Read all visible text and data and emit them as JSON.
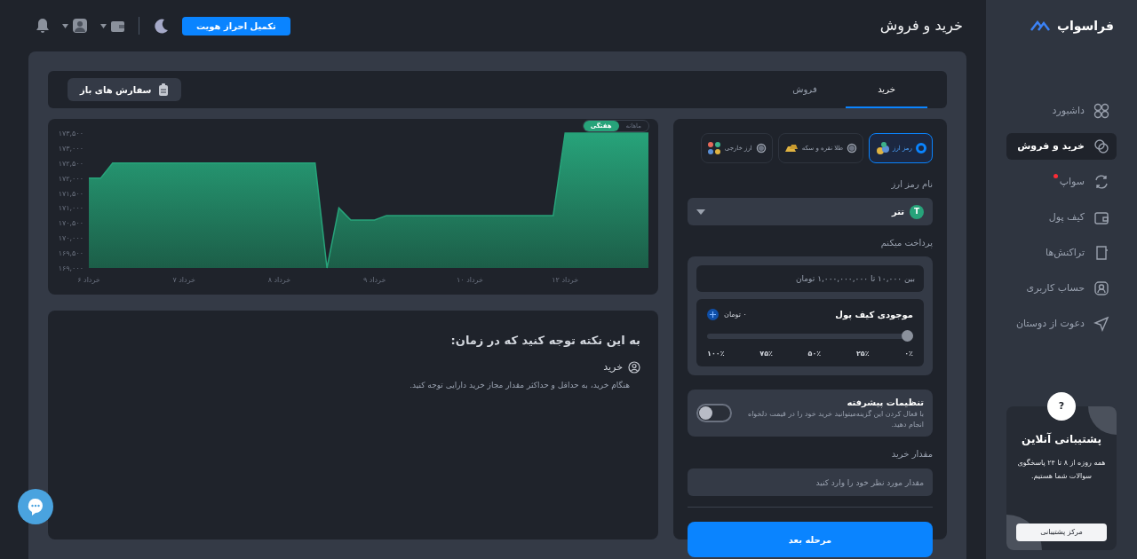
{
  "sidebar": {
    "logo": "فراسواپ",
    "items": [
      {
        "label": "داشبورد",
        "selected": false,
        "badge": false
      },
      {
        "label": "خرید و فروش",
        "selected": true,
        "badge": false
      },
      {
        "label": "سواپ",
        "selected": false,
        "badge": true
      },
      {
        "label": "کیف پول",
        "selected": false,
        "badge": false
      },
      {
        "label": "تراکنش‌ها",
        "selected": false,
        "badge": false
      },
      {
        "label": "حساب کاربری",
        "selected": false,
        "badge": false
      },
      {
        "label": "دعوت از دوستان",
        "selected": false,
        "badge": false
      }
    ],
    "support": {
      "badge": "?",
      "title": "پشتیبانی آنلاین",
      "text": "همه روزه از ۸ تا ۲۴ پاسخگوی سوالات شما هستیم.",
      "button": "مرکز پشتیبانی"
    }
  },
  "header": {
    "title": "خرید و فروش",
    "verify_button": "تکمیل احراز هویت"
  },
  "tabs": [
    {
      "label": "خرید",
      "selected": true
    },
    {
      "label": "فروش",
      "selected": false
    }
  ],
  "open_orders_button": "سفارش های باز",
  "chart": {
    "periods": [
      {
        "label": "ماهانه",
        "selected": false
      },
      {
        "label": "هفتگی",
        "selected": true
      }
    ],
    "chart_data": {
      "type": "area",
      "categories": [
        "۶ خرداد",
        null,
        null,
        null,
        null,
        null,
        null,
        null,
        "۷ خرداد",
        null,
        null,
        null,
        null,
        null,
        null,
        null,
        "۸ خرداد",
        null,
        null,
        null,
        null,
        null,
        null,
        null,
        "۹ خرداد",
        null,
        null,
        null,
        null,
        null,
        null,
        null,
        "۱۰ خرداد",
        null,
        null,
        null,
        null,
        null,
        null,
        null,
        "۱۲ خرداد",
        null,
        null,
        null,
        null,
        null,
        null,
        null
      ],
      "series": [
        {
          "color": "#27a37a",
          "values": [
            172000,
            172000,
            172500,
            172500,
            172500,
            172500,
            172500,
            172500,
            172500,
            172500,
            172500,
            172500,
            172500,
            172500,
            172500,
            172500,
            172500,
            172500,
            172500,
            172500,
            169000,
            171000,
            170600,
            170600,
            170600,
            170750,
            170750,
            170750,
            170750,
            170750,
            170750,
            170750,
            170750,
            170750,
            170750,
            170750,
            170750,
            170750,
            170750,
            170750,
            173500,
            173500,
            173500,
            173500,
            173500,
            173500,
            173500,
            173500
          ]
        }
      ],
      "ylim": [
        169000,
        173500
      ],
      "yticks": [
        {
          "value": 169000,
          "label": "۱۶۹,۰۰۰"
        },
        {
          "value": 169500,
          "label": "۱۶۹,۵۰۰"
        },
        {
          "value": 170000,
          "label": "۱۷۰,۰۰۰"
        },
        {
          "value": 170500,
          "label": "۱۷۰,۵۰۰"
        },
        {
          "value": 171000,
          "label": "۱۷۱,۰۰۰"
        },
        {
          "value": 171500,
          "label": "۱۷۱,۵۰۰"
        },
        {
          "value": 172000,
          "label": "۱۷۲,۰۰۰"
        },
        {
          "value": 172500,
          "label": "۱۷۲,۵۰۰"
        },
        {
          "value": 173000,
          "label": "۱۷۳,۰۰۰"
        },
        {
          "value": 173500,
          "label": "۱۷۳,۵۰۰"
        }
      ]
    }
  },
  "notes": {
    "title": "به این نکته توجه کنید که در زمان:",
    "items": [
      {
        "title": "خرید",
        "text": "هنگام خرید، به حداقل و حداکثر مقدار مجاز خرید دارایی توجه کنید."
      }
    ]
  },
  "form": {
    "asset_types": [
      {
        "label": "رمز ارز",
        "selected": true
      },
      {
        "label": "طلا نقره و سکه",
        "selected": false
      },
      {
        "label": "ارز خارجی",
        "selected": false
      }
    ],
    "asset_label": "نام رمز ارز",
    "asset": {
      "symbol": "T",
      "name": "تتر"
    },
    "pay_label": "پرداخت میکنم",
    "pay_placeholder": "بین ۱۰,۰۰۰ تا ۱,۰۰۰,۰۰۰,۰۰۰ تومان",
    "wallet": {
      "label": "موجودی کیف پول",
      "balance": "۰ تومان",
      "marks": [
        "۰٪",
        "۲۵٪",
        "۵۰٪",
        "۷۵٪",
        "۱۰۰٪"
      ]
    },
    "advanced": {
      "title": "تنظیمات پیشرفته",
      "text": "با فعال کردن این گزینه‌میتوانید خرید خود را در قیمت دلخواه انجام دهید.",
      "on": false
    },
    "amount_label": "مقدار خرید",
    "amount_placeholder": "مقدار مورد نظر خود را وارد کنید",
    "next_button": "مرحله بعد"
  }
}
